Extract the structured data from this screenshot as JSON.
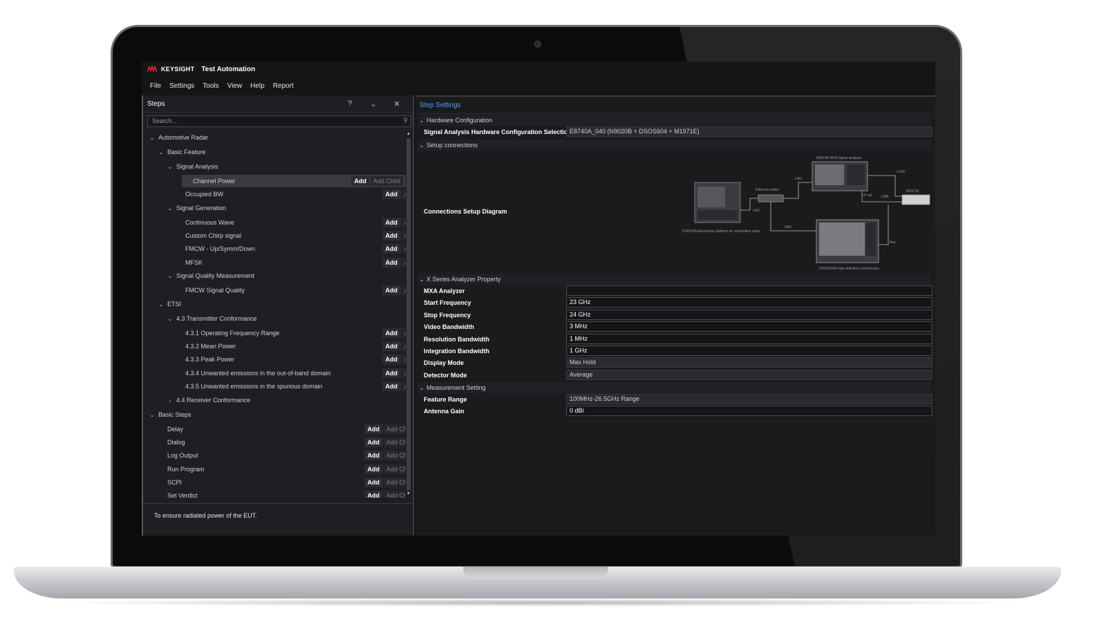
{
  "app": {
    "brand": "KEYSIGHT",
    "title": "Test Automation"
  },
  "menu": [
    "File",
    "Settings",
    "Tools",
    "View",
    "Help",
    "Report"
  ],
  "steps_panel": {
    "title": "Steps",
    "help": "?",
    "search_placeholder": "Search...",
    "add_label": "Add",
    "add_child_label": "Add Child",
    "description": "To ensure radiated power of the EUT."
  },
  "tree": [
    {
      "label": "Automotive Radar",
      "level": 0,
      "expand": "open",
      "buttons": false
    },
    {
      "label": "Basic Feature",
      "level": 1,
      "expand": "open",
      "buttons": false
    },
    {
      "label": "Signal Analysis",
      "level": 2,
      "expand": "open",
      "buttons": false
    },
    {
      "label": "Channel Power",
      "level": 3,
      "expand": "none",
      "buttons": true,
      "selected": true
    },
    {
      "label": "Occupied BW",
      "level": 3,
      "expand": "none",
      "buttons": true
    },
    {
      "label": "Signal Generation",
      "level": 2,
      "expand": "open",
      "buttons": false
    },
    {
      "label": "Continuous Wave",
      "level": 3,
      "expand": "none",
      "buttons": true
    },
    {
      "label": "Custom Chirp signal",
      "level": 3,
      "expand": "none",
      "buttons": true
    },
    {
      "label": "FMCW - Up/Symm/Down",
      "level": 3,
      "expand": "none",
      "buttons": true
    },
    {
      "label": "MFSK",
      "level": 3,
      "expand": "none",
      "buttons": true
    },
    {
      "label": "Signal Quality Measurement",
      "level": 2,
      "expand": "open",
      "buttons": false
    },
    {
      "label": "FMCW Signal Quality",
      "level": 3,
      "expand": "none",
      "buttons": true
    },
    {
      "label": "ETSI",
      "level": 1,
      "expand": "open",
      "buttons": false
    },
    {
      "label": "4.3 Transmitter Conformance",
      "level": 2,
      "expand": "open",
      "buttons": false
    },
    {
      "label": "4.3.1 Operating Frequency Range",
      "level": 3,
      "expand": "none",
      "buttons": true
    },
    {
      "label": "4.3.2 Mean Power",
      "level": 3,
      "expand": "none",
      "buttons": true
    },
    {
      "label": "4.3.3 Peak Power",
      "level": 3,
      "expand": "none",
      "buttons": true
    },
    {
      "label": "4.3.4 Unwanted emissions in the out-of-band domain",
      "level": 3,
      "expand": "none",
      "buttons": true
    },
    {
      "label": "4.3.5 Unwanted emissions in the spurious domain",
      "level": 3,
      "expand": "none",
      "buttons": true
    },
    {
      "label": "4.4 Receiver Conformance",
      "level": 2,
      "expand": "closed",
      "buttons": false
    },
    {
      "label": "Basic Steps",
      "level": 0,
      "expand": "open",
      "buttons": false
    },
    {
      "label": "Delay",
      "level": 1,
      "expand": "none",
      "buttons": true
    },
    {
      "label": "Dialog",
      "level": 1,
      "expand": "none",
      "buttons": true
    },
    {
      "label": "Log Output",
      "level": 1,
      "expand": "none",
      "buttons": true
    },
    {
      "label": "Run Program",
      "level": 1,
      "expand": "none",
      "buttons": true
    },
    {
      "label": "SCPI",
      "level": 1,
      "expand": "none",
      "buttons": true
    },
    {
      "label": "Set Verdict",
      "level": 1,
      "expand": "none",
      "buttons": true
    }
  ],
  "settings": {
    "title": "Step Settings",
    "sections": {
      "hardware": "Hardware Configuration",
      "setup": "Setup connections",
      "xseries": "X Series Analyzer Property",
      "measurement": "Measurement Setting"
    },
    "hw_label": "Signal Analysis Hardware Configuration Selection",
    "hw_value": "E8740A_040 (N9020B + DSOS604 + M1971E)",
    "diagram_label": "Connections Setup Diagram",
    "diagram": {
      "mxa": "N9020B MXA Signal analyzer",
      "switch": "Ethernet switch",
      "lan1": "LAN",
      "lan2": "LAN",
      "lan3": "LAN",
      "lo": "LO/IF",
      "usb": "USB",
      "ifout": "IF out",
      "m1971": "M1971E",
      "aux": "Aux",
      "platform": "KS0020A Automotive platform for automotive radar",
      "dsos": "DSOS604A high-definition oscilloscope"
    },
    "xseries_props": [
      {
        "label": "MXA Analyzer",
        "value": "",
        "dropdown": false
      },
      {
        "label": "Start Frequency",
        "value": "23 GHz",
        "dropdown": false
      },
      {
        "label": "Stop Frequency",
        "value": "24 GHz",
        "dropdown": false
      },
      {
        "label": "Video Bandwidth",
        "value": "3 MHz",
        "dropdown": false
      },
      {
        "label": "Resolution Bandwidth",
        "value": "1 MHz",
        "dropdown": false
      },
      {
        "label": "Integration Bandwidth",
        "value": "1 GHz",
        "dropdown": false
      },
      {
        "label": "Display Mode",
        "value": "Max Hold",
        "dropdown": true
      },
      {
        "label": "Detector Mode",
        "value": "Average",
        "dropdown": true
      }
    ],
    "measurement_props": [
      {
        "label": "Feature Range",
        "value": "100MHz-26.5GHz Range",
        "dropdown": true
      },
      {
        "label": "Antenna Gain",
        "value": "0 dBi",
        "dropdown": false
      }
    ]
  },
  "colors": {
    "accent": "#4aa3ff",
    "brand_red": "#e01e37"
  }
}
